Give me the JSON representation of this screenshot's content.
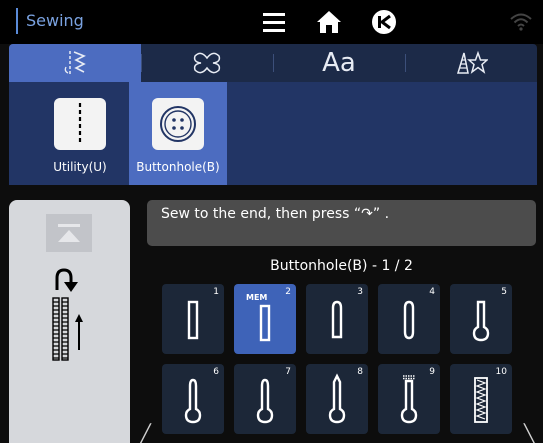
{
  "topbar": {
    "title": "Sewing",
    "icons": [
      "menu-icon",
      "home-icon",
      "back-icon",
      "wifi-icon"
    ]
  },
  "tabs": [
    {
      "name": "utility-stitches",
      "icon": "stitch-pattern-icon",
      "active": true
    },
    {
      "name": "decorative-stitches",
      "icon": "decorative-icon",
      "active": false
    },
    {
      "name": "lettering",
      "label": "Aa",
      "active": false
    },
    {
      "name": "my-design",
      "icon": "pyramid-star-icon",
      "active": false
    }
  ],
  "categories": [
    {
      "label": "Utility(U)",
      "icon": "straight-stitch-icon",
      "active": false
    },
    {
      "label": "Buttonhole(B)",
      "icon": "button-icon",
      "active": true
    }
  ],
  "message": "Sew to the end, then press “↷” .",
  "pattern_header": "Buttonhole(B) - 1 / 2",
  "stitches": [
    {
      "num": "1",
      "shape": "rect",
      "selected": false
    },
    {
      "num": "2",
      "shape": "rect",
      "selected": true,
      "tag": "MEM"
    },
    {
      "num": "3",
      "shape": "round",
      "selected": false
    },
    {
      "num": "4",
      "shape": "round",
      "selected": false
    },
    {
      "num": "5",
      "shape": "keyhole",
      "selected": false
    },
    {
      "num": "6",
      "shape": "keyhole",
      "selected": false
    },
    {
      "num": "7",
      "shape": "keyhole",
      "selected": false
    },
    {
      "num": "8",
      "shape": "keyhole-pointed",
      "selected": false
    },
    {
      "num": "9",
      "shape": "keyhole-bar",
      "selected": false
    },
    {
      "num": "10",
      "shape": "zigzag",
      "selected": false
    }
  ],
  "colors": {
    "accent": "#4c6cc0",
    "tabbar": "#1c2a48",
    "panel": "#223565",
    "tile": "#1c2738",
    "message": "#4c4c4c"
  }
}
